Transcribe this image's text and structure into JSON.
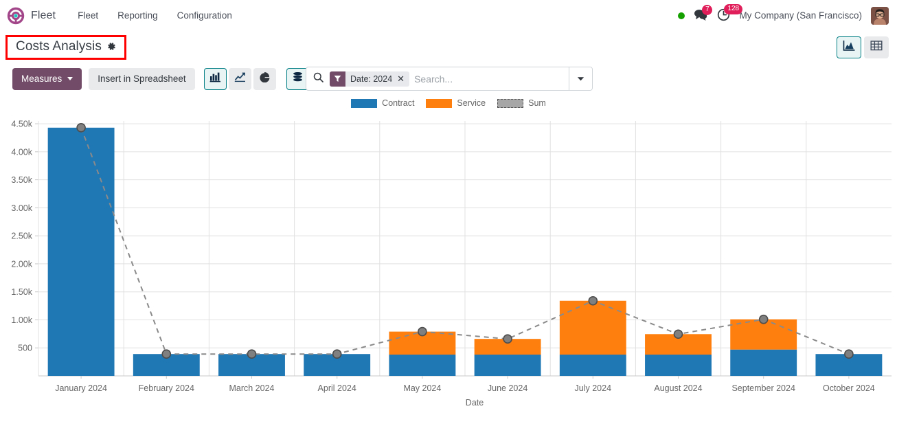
{
  "navbar": {
    "brand": "Fleet",
    "brand_icon": "steering-wheel-icon",
    "links": [
      "Fleet",
      "Reporting",
      "Configuration"
    ],
    "status_icon": "online-status-dot",
    "messages_icon": "chat-bubble-icon",
    "messages_count": "7",
    "activities_icon": "clock-activity-icon",
    "activities_count": "128",
    "company": "My Company (San Francisco)",
    "avatar_icon": "user-avatar"
  },
  "control_panel": {
    "title": "Costs Analysis",
    "title_gear_icon": "gear-icon",
    "search": {
      "search_icon": "search-icon",
      "facet_icon": "filter-icon",
      "facet_label": "Date: 2024",
      "facet_remove_icon": "close-icon",
      "placeholder": "Search...",
      "value": "",
      "toggle_icon": "chevron-down-icon"
    },
    "views": [
      {
        "name": "graph-view",
        "icon": "area-chart-icon",
        "active": true
      },
      {
        "name": "pivot-view",
        "icon": "table-grid-icon",
        "active": false
      }
    ]
  },
  "toolbar": {
    "measures_label": "Measures",
    "measures_caret_icon": "caret-down-icon",
    "spreadsheet_label": "Insert in Spreadsheet",
    "chart_types": [
      {
        "name": "bar-chart",
        "icon": "bar-chart-icon",
        "active": true
      },
      {
        "name": "line-chart",
        "icon": "line-chart-icon",
        "active": false
      },
      {
        "name": "pie-chart",
        "icon": "pie-chart-icon",
        "active": false
      }
    ],
    "options": [
      {
        "name": "stacked",
        "icon": "stacked-icon",
        "active": true
      }
    ],
    "sorts": [
      {
        "name": "sort-descending",
        "icon": "sort-desc-icon",
        "active": false
      },
      {
        "name": "sort-ascending",
        "icon": "sort-asc-icon",
        "active": false
      }
    ]
  },
  "chart_data": {
    "type": "bar",
    "stacked": true,
    "title": "",
    "xlabel": "Date",
    "ylabel": "",
    "grid": true,
    "legend_position": "top",
    "categories": [
      "January 2024",
      "February 2024",
      "March 2024",
      "April 2024",
      "May 2024",
      "June 2024",
      "July 2024",
      "August 2024",
      "September 2024",
      "October 2024"
    ],
    "series": [
      {
        "name": "Contract",
        "color": "#1f77b4",
        "type": "bar",
        "values": [
          4430,
          390,
          390,
          390,
          380,
          380,
          380,
          380,
          470,
          390
        ]
      },
      {
        "name": "Service",
        "color": "#ff7f0e",
        "type": "bar",
        "values": [
          0,
          0,
          0,
          0,
          410,
          280,
          960,
          365,
          540,
          0
        ]
      },
      {
        "name": "Sum",
        "color": "#a7a7a7",
        "type": "line",
        "style": "dashed",
        "values": [
          4430,
          390,
          390,
          390,
          790,
          660,
          1340,
          745,
          1010,
          390
        ]
      }
    ],
    "ytick_labels": [
      "500",
      "1.00k",
      "1.50k",
      "2.00k",
      "2.50k",
      "3.00k",
      "3.50k",
      "4.00k",
      "4.50k"
    ],
    "ytick_values": [
      500,
      1000,
      1500,
      2000,
      2500,
      3000,
      3500,
      4000,
      4500
    ],
    "ylim": [
      0,
      4550
    ]
  }
}
